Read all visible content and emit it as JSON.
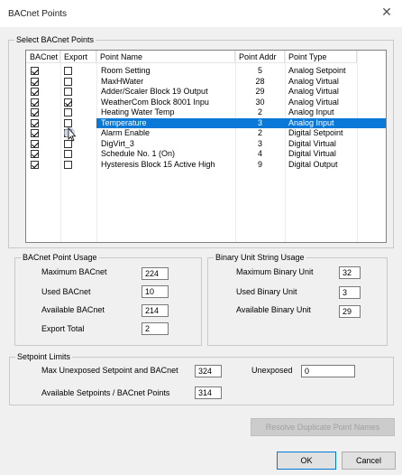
{
  "window": {
    "title": "BACnet Points",
    "close_glyph": "✕"
  },
  "select_group": {
    "legend": "Select BACnet Points"
  },
  "list": {
    "headers": {
      "bacnet": "BACnet",
      "export": "Export",
      "name": "Point Name",
      "addr": "Point Addr",
      "type": "Point Type"
    },
    "rows": [
      {
        "bacnet": true,
        "export": false,
        "name": "Room Setting",
        "addr": "5",
        "type": "Analog Setpoint",
        "selected": false
      },
      {
        "bacnet": true,
        "export": false,
        "name": "MaxHWater",
        "addr": "28",
        "type": "Analog Virtual",
        "selected": false
      },
      {
        "bacnet": true,
        "export": false,
        "name": "Adder/Scaler Block 19 Output",
        "addr": "29",
        "type": "Analog Virtual",
        "selected": false
      },
      {
        "bacnet": true,
        "export": true,
        "name": "WeatherCom Block 8001 Inpu",
        "addr": "30",
        "type": "Analog Virtual",
        "selected": false
      },
      {
        "bacnet": true,
        "export": false,
        "name": "Heating Water Temp",
        "addr": "2",
        "type": "Analog Input",
        "selected": false
      },
      {
        "bacnet": true,
        "export": false,
        "name": "Temperature",
        "addr": "3",
        "type": "Analog Input",
        "selected": true
      },
      {
        "bacnet": true,
        "export": false,
        "name": "Alarm Enable",
        "addr": "2",
        "type": "Digital Setpoint",
        "selected": false
      },
      {
        "bacnet": true,
        "export": false,
        "name": "DigVirt_3",
        "addr": "3",
        "type": "Digital Virtual",
        "selected": false
      },
      {
        "bacnet": true,
        "export": false,
        "name": "Schedule No. 1 (On)",
        "addr": "4",
        "type": "Digital Virtual",
        "selected": false
      },
      {
        "bacnet": true,
        "export": false,
        "name": "Hysteresis Block 15 Active High",
        "addr": "9",
        "type": "Digital Output",
        "selected": false
      }
    ]
  },
  "usage": {
    "legend": "BACnet Point Usage",
    "max_label": "Maximum BACnet",
    "max_value": "224",
    "used_label": "Used BACnet",
    "used_value": "10",
    "avail_label": "Available BACnet",
    "avail_value": "214",
    "export_label": "Export Total",
    "export_value": "2"
  },
  "binary": {
    "legend": "Binary Unit String Usage",
    "max_label": "Maximum Binary Unit",
    "max_value": "32",
    "used_label": "Used Binary Unit",
    "used_value": "3",
    "avail_label": "Available Binary Unit",
    "avail_value": "29"
  },
  "setpoint": {
    "legend": "Setpoint Limits",
    "max_label": "Max Unexposed Setpoint and BACnet",
    "max_value": "324",
    "unexposed_label": "Unexposed",
    "unexposed_value": "0",
    "avail_label": "Available Setpoints / BACnet Points",
    "avail_value": "314"
  },
  "buttons": {
    "resolve": "Resolve Duplicate Point Names",
    "ok": "OK",
    "cancel": "Cancel"
  }
}
